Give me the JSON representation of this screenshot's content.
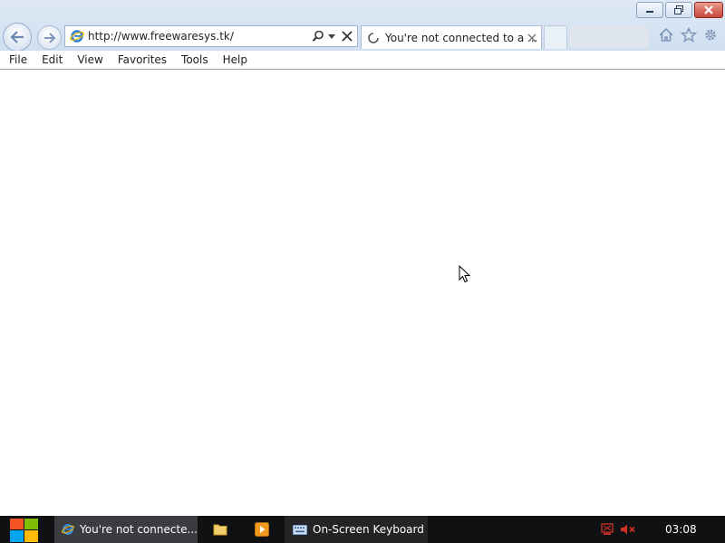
{
  "window": {
    "controls": {
      "minimize": "minimize",
      "restore": "restore",
      "close": "close"
    }
  },
  "toolbar": {
    "address_url": "http://www.freewaresys.tk/",
    "tab_title": "You're not connected to a ...",
    "icons": [
      "back-icon",
      "forward-icon",
      "ie-icon",
      "search-icon",
      "dropdown-icon",
      "stop-icon",
      "spinner-icon",
      "close-tab-icon",
      "home-icon",
      "favorites-star-icon",
      "tools-gear-icon"
    ]
  },
  "menubar": {
    "items": [
      "File",
      "Edit",
      "View",
      "Favorites",
      "Tools",
      "Help"
    ]
  },
  "taskbar": {
    "ie_task_label": "You're not connecte...",
    "keyboard_task_label": "On-Screen Keyboard",
    "clock": "03:08"
  },
  "colors": {
    "chrome": "#d6e4f3",
    "taskbar": "#101112",
    "close_button": "#c7463a",
    "muted_volume": "#d0302a"
  }
}
